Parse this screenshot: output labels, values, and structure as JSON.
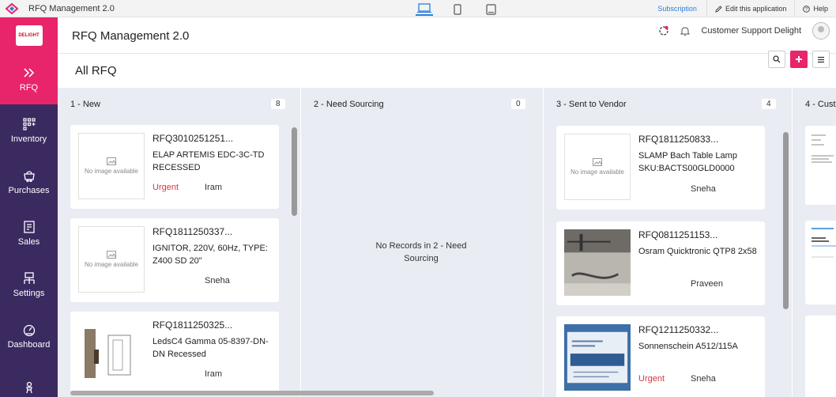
{
  "topbar": {
    "app_name": "RFQ Management 2.0",
    "subscription": "Subscription",
    "edit_app": "Edit this application",
    "help": "Help"
  },
  "sidebar": {
    "logo_text": "DELIGHT",
    "items": [
      {
        "label": "RFQ",
        "icon": "double-chevron-icon",
        "active": true
      },
      {
        "label": "Inventory",
        "icon": "grid-plus-icon"
      },
      {
        "label": "Purchases",
        "icon": "cart-icon"
      },
      {
        "label": "Sales",
        "icon": "sales-icon"
      },
      {
        "label": "Settings",
        "icon": "settings-icon"
      },
      {
        "label": "Dashboard",
        "icon": "gauge-icon"
      },
      {
        "label": "",
        "icon": "person-icon"
      }
    ]
  },
  "header": {
    "title": "RFQ Management 2.0",
    "user_name": "Customer Support Delight"
  },
  "subheader": {
    "title": "All RFQ"
  },
  "columns": [
    {
      "title": "1 - New",
      "count": "8",
      "cards": [
        {
          "id": "RFQ3010251251...",
          "name": "ELAP ARTEMIS EDC-3C-TD RECESSED",
          "priority": "Urgent",
          "owner": "Iram",
          "image": "No image available"
        },
        {
          "id": "RFQ1811250337...",
          "name": "IGNITOR, 220V, 60Hz, TYPE: Z400 SD 20\"",
          "priority": "",
          "owner": "Sneha",
          "image": "No image available"
        },
        {
          "id": "RFQ1811250325...",
          "name": "LedsC4 Gamma 05-8397-DN-DN Recessed",
          "priority": "",
          "owner": "Iram",
          "image": ""
        }
      ]
    },
    {
      "title": "2 - Need Sourcing",
      "count": "0",
      "empty_text": "No Records in 2 - Need Sourcing"
    },
    {
      "title": "3 - Sent to Vendor",
      "count": "4",
      "cards": [
        {
          "id": "RFQ1811250833...",
          "name": "SLAMP Bach Table Lamp SKU:BACTS00GLD0000",
          "priority": "",
          "owner": "Sneha",
          "image": "No image available"
        },
        {
          "id": "RFQ0811251153...",
          "name": "Osram Quicktronic QTP8 2x58",
          "priority": "",
          "owner": "Praveen",
          "image": ""
        },
        {
          "id": "RFQ1211250332...",
          "name": "Sonnenschein A512/115A",
          "priority": "Urgent",
          "owner": "Sneha",
          "image": ""
        }
      ]
    },
    {
      "title": "4 - Cust",
      "count": ""
    }
  ],
  "colors": {
    "accent": "#e8246a",
    "sidebar": "#3b2a60",
    "board": "#e9ecf3",
    "urgent": "#d9363e"
  }
}
